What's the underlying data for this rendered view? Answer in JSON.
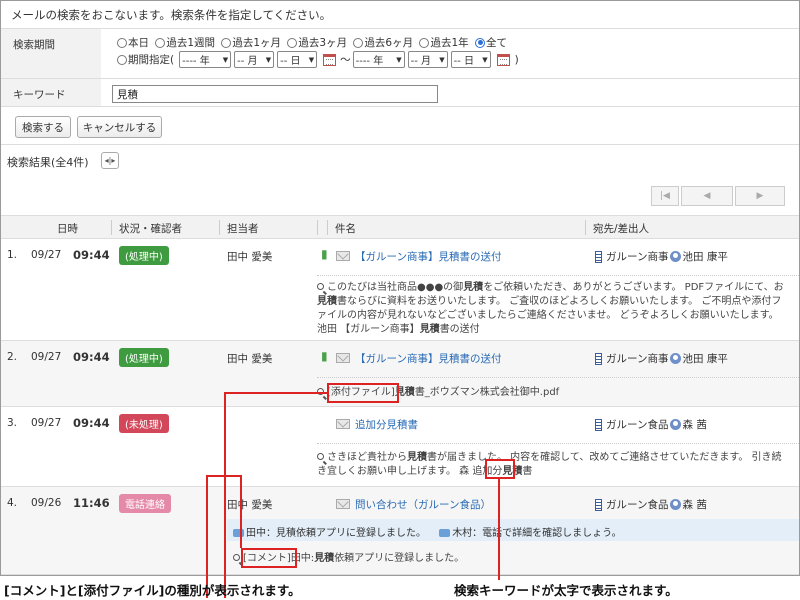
{
  "intro_text": "メールの検索をおこないます。検索条件を指定してください。",
  "search_period": {
    "label": "検索期間",
    "options": [
      "本日",
      "過去1週間",
      "過去1ヶ月",
      "過去3ヶ月",
      "過去6ヶ月",
      "過去1年",
      "全て"
    ],
    "selected": "全て",
    "custom_label": "期間指定(",
    "custom_close": ")",
    "range_separator": "〜",
    "year_placeholder": "---- 年",
    "month_placeholder": "-- 月",
    "day_placeholder": "-- 日"
  },
  "keyword": {
    "label": "キーワード",
    "value": "見積"
  },
  "buttons": {
    "search": "検索する",
    "cancel": "キャンセルする"
  },
  "results_title": "検索結果(全4件)",
  "columns": [
    "日時",
    "状況・確認者",
    "担当者",
    "件名",
    "宛先/差出人"
  ],
  "rows": [
    {
      "num": "1.",
      "date": "09/27",
      "time": "09:44",
      "status": "(処理中)",
      "status_color": "#3f9b3f",
      "person": "田中 愛美",
      "subject": "【ガルーン商事】見積書の送付",
      "company": "ガルーン商事",
      "contact": "池田 康平",
      "snippet_parts": [
        "このたびは当社商品●●●の御",
        "見積",
        "をご依頼いただき、ありがとうございます。 PDFファイルにて、お",
        "見積",
        "書ならびに資料をお送りいたします。 ご査収のほどよろしくお願いいたします。 ご不明点や添付ファイルの内容が見れないなどございましたらご連絡くださいませ。 どうぞよろしくお願いいたします。 池田 【ガルーン商事】",
        "見積",
        "書の送付"
      ]
    },
    {
      "num": "2.",
      "date": "09/27",
      "time": "09:44",
      "status": "(処理中)",
      "status_color": "#3f9b3f",
      "person": "田中 愛美",
      "subject": "【ガルーン商事】見積書の送付",
      "company": "ガルーン商事",
      "contact": "池田 康平",
      "attach_tag": "[添付ファイル]",
      "attach_parts": [
        "見積",
        "書_ボウズマン株式会社御中.pdf"
      ]
    },
    {
      "num": "3.",
      "date": "09/27",
      "time": "09:44",
      "status": "(未処理)",
      "status_color": "#d2475a",
      "person": "",
      "subject": "追加分見積書",
      "company": "ガルーン食品",
      "contact": "森 茜",
      "snippet_parts": [
        "さきほど貴社から",
        "見積",
        "書が届きました。 内容を確認して、改めてご連絡させていただきます。 引き続き宜しくお願い申し上げます。 森 追加分",
        "見積",
        "書"
      ]
    },
    {
      "num": "4.",
      "date": "09/26",
      "time": "11:46",
      "status": "電話連絡",
      "status_color": "#e48aa8",
      "person": "田中 愛美",
      "subject": "問い合わせ（ガルーン食品）",
      "company": "ガルーン食品",
      "contact": "森 茜",
      "comment1": "田中：見積依頼アプリに登録しました。",
      "comment2": "木村：電話で詳細を確認しましょう。",
      "comment_tag": "[コメント]",
      "comment_parts": [
        "田中:",
        "見積",
        "依頼アプリに登録しました。"
      ]
    }
  ],
  "captions": {
    "left": "[コメント]と[添付ファイル]の種別が表示されます。",
    "right": "検索キーワードが太字で表示されます。"
  },
  "colors": {
    "link": "#2a6bb5",
    "annotation": "#dd2222",
    "selected_radio": "#2c6ed5"
  }
}
